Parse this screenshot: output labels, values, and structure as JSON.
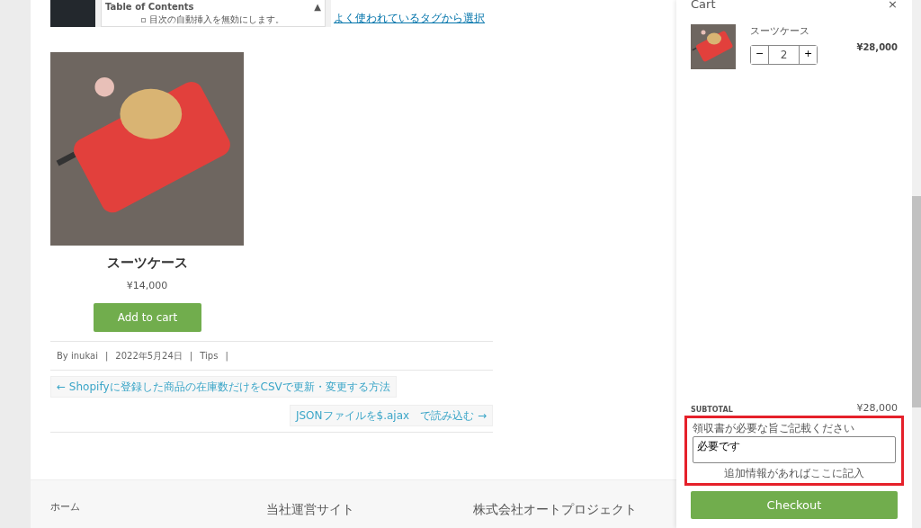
{
  "embedded_screenshot": {
    "panel_title": "Table of Contents",
    "panel_toggle": "▲",
    "checkbox_label": "目次の自動挿入を無効にします。",
    "checkbox_checked": false,
    "side_link": "よく使われているタグから選択"
  },
  "product": {
    "name": "スーツケース",
    "price": "¥14,000",
    "button": "Add to cart"
  },
  "meta": [
    {
      "text": "By inukai",
      "separator": "|"
    },
    {
      "text": "2022年5月24日",
      "separator": "|"
    },
    {
      "text": "Tips",
      "separator": "|"
    }
  ],
  "post_nav": {
    "previous": "← Shopifyに登録した商品の在庫数だけをCSVで更新・変更する方法",
    "next": "JSONファイルを$.ajax　で読み込む →"
  },
  "footer": [
    "ホーム",
    "当社運営サイト",
    "株式会社オートプロジェクト"
  ],
  "cart": {
    "title": "Cart",
    "close": "×",
    "items": [
      {
        "name": "スーツケース",
        "quantity": "2",
        "minus": "−",
        "plus": "+",
        "price": "¥28,000"
      }
    ],
    "subtotal_label": "SUBTOTAL",
    "subtotal": "¥28,000",
    "note_label": "領収書が必要な旨ご記載ください",
    "note_value": "必要です",
    "note_hint": "追加情報があればここに記入",
    "note_highlighted": true,
    "checkout": "Checkout"
  }
}
